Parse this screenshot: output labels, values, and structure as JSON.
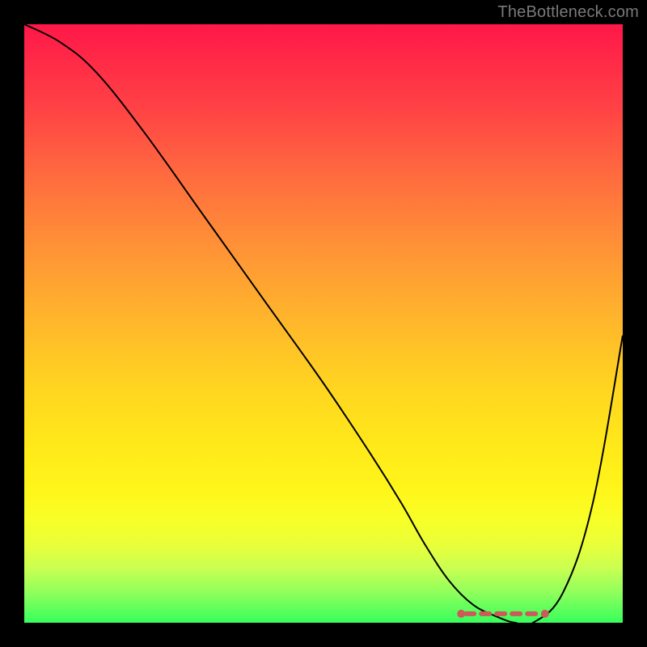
{
  "watermark": "TheBottleneck.com",
  "chart_data": {
    "type": "line",
    "title": "",
    "xlabel": "",
    "ylabel": "",
    "xlim": [
      0,
      100
    ],
    "ylim": [
      0,
      100
    ],
    "grid": false,
    "series": [
      {
        "name": "curve",
        "x": [
          0,
          6,
          12,
          20,
          30,
          40,
          50,
          58,
          63,
          67,
          71,
          75,
          79,
          82,
          85,
          90,
          95,
          100
        ],
        "values": [
          100,
          97,
          92,
          82,
          68,
          54,
          40,
          28,
          20,
          13,
          7,
          3,
          1,
          0,
          0,
          5,
          20,
          48
        ]
      }
    ],
    "markers": {
      "x_range": [
        73,
        87
      ],
      "y": 1.5,
      "color": "#cc5a5a"
    },
    "gradient_stops": [
      {
        "pos": 0,
        "color": "#ff1748"
      },
      {
        "pos": 50,
        "color": "#ffc626"
      },
      {
        "pos": 80,
        "color": "#fff61a"
      },
      {
        "pos": 100,
        "color": "#36ff5c"
      }
    ]
  }
}
